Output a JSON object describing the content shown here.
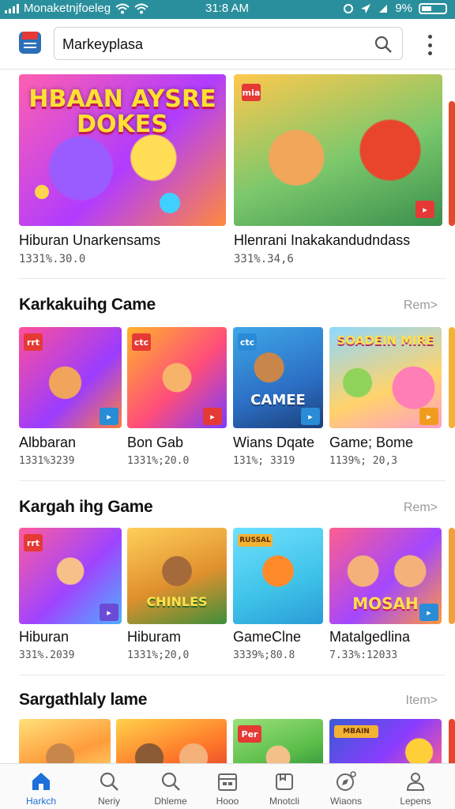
{
  "status": {
    "carrier": "Monaketnjfoeleg",
    "time": "31:8 AM",
    "battery": "9%"
  },
  "search": {
    "value": "Markeyplasa"
  },
  "hero": [
    {
      "title": "Hiburan Unarkensams",
      "meta": "1331%.30.0",
      "art_caption": "HBAAN AYSRE DOKES"
    },
    {
      "title": "Hlenrani Inakakandudndass",
      "meta": "331%.34,6",
      "art_badge": "mia"
    }
  ],
  "sections": [
    {
      "title": "Karkakuihg Came",
      "link": "Rem>",
      "items": [
        {
          "title": "Albbaran",
          "meta": "1331%3239",
          "badge": "rrt"
        },
        {
          "title": "Bon Gab",
          "meta": "1331%;20.0",
          "badge": "ctc"
        },
        {
          "title": "Wians Dqate",
          "meta": "131%; 3319",
          "badge": "ctc",
          "art_caption": "CAMEE"
        },
        {
          "title": "Game; Bome",
          "meta": "1139%; 20,3",
          "art_caption": "SOADEIN MIRE"
        }
      ]
    },
    {
      "title": "Kargah ihg Game",
      "link": "Rem>",
      "items": [
        {
          "title": "Hiburan",
          "meta": "331%.2039",
          "badge": "rrt"
        },
        {
          "title": "Hiburam",
          "meta": "1331%;20,0",
          "art_caption": "CHINLES"
        },
        {
          "title": "GameClne",
          "meta": "3339%;80.8",
          "art_caption": "RUSSAL"
        },
        {
          "title": "Matalgedlina",
          "meta": "7.33%:12033",
          "art_caption": "MOSAH"
        }
      ]
    },
    {
      "title": "Sargathlaly lame",
      "link": "Item>",
      "items": [
        {
          "title": "",
          "meta": ""
        },
        {
          "title": "",
          "meta": ""
        },
        {
          "title": "",
          "meta": "",
          "badge": "Per"
        },
        {
          "title": "",
          "meta": "",
          "art_caption": "MBAIN"
        }
      ]
    }
  ],
  "nav": [
    {
      "label": "Harkch",
      "icon": "home-icon"
    },
    {
      "label": "Neriy",
      "icon": "search-icon"
    },
    {
      "label": "Dhleme",
      "icon": "search-icon"
    },
    {
      "label": "Hooo",
      "icon": "calendar-icon"
    },
    {
      "label": "Mnotcli",
      "icon": "library-icon"
    },
    {
      "label": "Wiaons",
      "icon": "compass-icon"
    },
    {
      "label": "Lepens",
      "icon": "profile-icon"
    }
  ],
  "colors": {
    "statusbar": "#2a8f9c",
    "accent": "#1e6fd9"
  }
}
